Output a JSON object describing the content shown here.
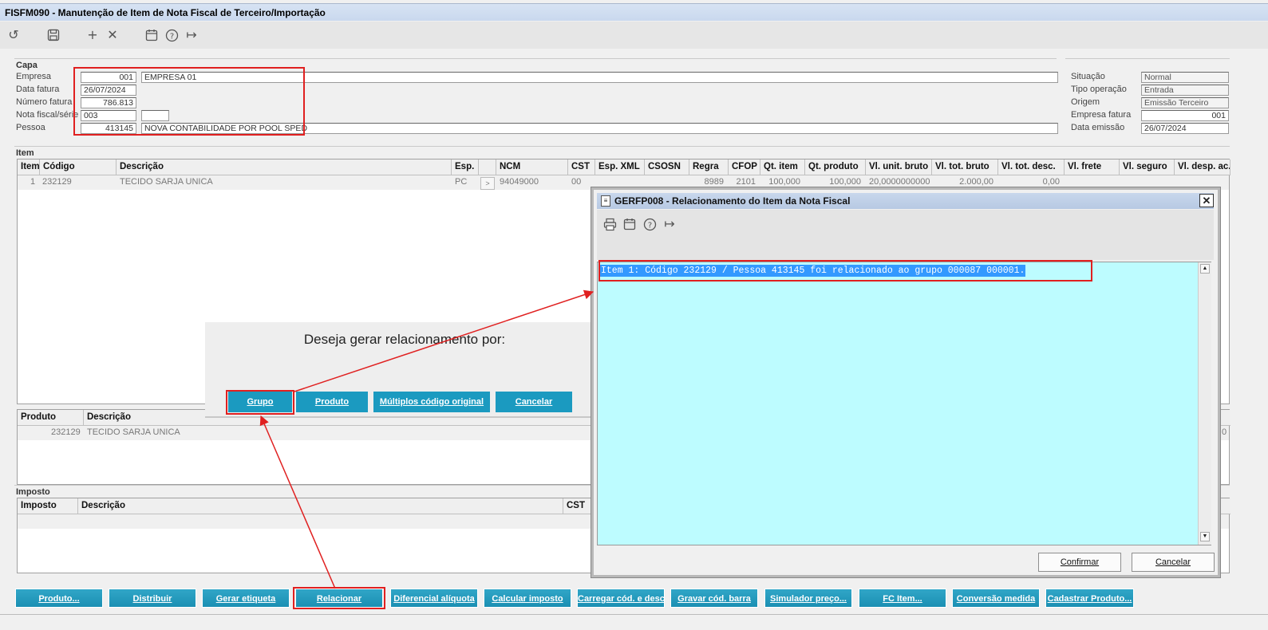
{
  "window": {
    "title": "FISFM090 - Manutenção de Item de Nota Fiscal de Terceiro/Importação"
  },
  "toolbar": {
    "icons": [
      "undo-icon",
      "save-icon",
      "add-icon",
      "delete-icon",
      "calendar-icon",
      "help-icon",
      "exit-icon"
    ]
  },
  "capa": {
    "section_label": "Capa",
    "empresa_label": "Empresa",
    "empresa_code": "001",
    "empresa_name": "EMPRESA 01",
    "data_fatura_label": "Data fatura",
    "data_fatura": "26/07/2024",
    "numero_fatura_label": "Número fatura",
    "numero_fatura": "786.813",
    "nota_fiscal_label": "Nota fiscal/série",
    "nota_fiscal": "003",
    "serie": "",
    "pessoa_label": "Pessoa",
    "pessoa_code": "413145",
    "pessoa_name": "NOVA CONTABILIDADE POR POOL SPED",
    "situacao_label": "Situação",
    "situacao": "Normal",
    "tipo_operacao_label": "Tipo operação",
    "tipo_operacao": "Entrada",
    "origem_label": "Origem",
    "origem": "Emissão Terceiro",
    "empresa_fatura_label": "Empresa fatura",
    "empresa_fatura": "001",
    "data_emissao_label": "Data emissão",
    "data_emissao": "26/07/2024"
  },
  "item": {
    "section_label": "Item",
    "columns": [
      "Item",
      "Código",
      "Descrição",
      "Esp.",
      "",
      "NCM",
      "CST",
      "Esp. XML",
      "CSOSN",
      "Regra",
      "CFOP",
      "Qt. item",
      "Qt. produto",
      "Vl. unit. bruto",
      "Vl. tot. bruto",
      "Vl. tot. desc.",
      "Vl. frete",
      "Vl. seguro",
      "Vl. desp. ac."
    ],
    "row": {
      "item": "1",
      "codigo": "232129",
      "descricao": "TECIDO SARJA UNICA",
      "esp": "PC",
      "btn": ">",
      "ncm": "94049000",
      "cst": "00",
      "regra": "8989",
      "cfop": "2101",
      "qt_item": "100,000",
      "qt_produto": "100,000",
      "vl_unit_bruto": "20,0000000000",
      "vl_tot_bruto": "2.000,00",
      "vl_tot_desc": "0,00"
    }
  },
  "produto_grid": {
    "columns": [
      "Produto",
      "Descrição"
    ],
    "row": {
      "produto": "232129",
      "descricao": "TECIDO SARJA UNICA",
      "trail": "0"
    }
  },
  "imposto": {
    "section_label": "Imposto",
    "columns": [
      "Imposto",
      "Descrição",
      "CST"
    ]
  },
  "prompt_dialog": {
    "question": "Deseja gerar relacionamento por:",
    "buttons": [
      "Grupo",
      "Produto",
      "Múltiplos código original",
      "Cancelar"
    ]
  },
  "gerfp_window": {
    "title": "GERFP008 - Relacionamento do Item da Nota Fiscal",
    "close": "✕",
    "message": "Item 1: Código 232129 / Pessoa 413145 foi relacionado ao grupo 000087 000001.",
    "confirm": "Confirmar",
    "cancel": "Cancelar",
    "icons": [
      "print-icon",
      "calendar-icon",
      "help-icon",
      "exit-icon"
    ]
  },
  "bottom_buttons": [
    "Produto...",
    "Distribuir",
    "Gerar etiqueta",
    "Relacionar",
    "Diferencial alíquota",
    "Calcular imposto",
    "Carregar cód. e desc.",
    "Gravar cód. barra",
    "Simulador preço...",
    "FC Item...",
    "Conversão medida",
    "Cadastrar Produto..."
  ],
  "colors": {
    "accent": "#1b8fb3",
    "highlight": "#e02020",
    "message_bg": "#bdfcff",
    "selection": "#3399ff"
  }
}
